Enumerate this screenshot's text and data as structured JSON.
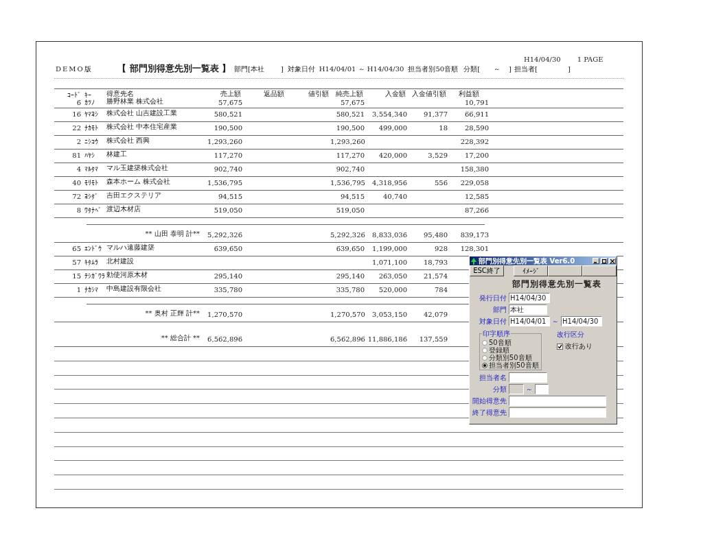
{
  "report": {
    "edition": "DEMO版",
    "title": "【 部門別得意先別一覧表 】",
    "department": "部門[本社",
    "department_close": "]",
    "period_label": "対象日付",
    "period": "H14/04/01 ～ H14/04/30",
    "order": "担当者別50音順",
    "category_open": "分類[",
    "category_tilde": "～",
    "category_close": "]",
    "staff_open": "担当者[",
    "staff_close": "]",
    "issue_date": "H14/04/30",
    "page": "1 PAGE"
  },
  "table": {
    "columns": [
      "ｺｰﾄﾞ",
      "ｷｰ",
      "得意先名",
      "売上額",
      "返品額",
      "値引額",
      "純売上額",
      "入金額",
      "入金値引額",
      "利益額"
    ],
    "rows": [
      {
        "kind": "item",
        "code": "6",
        "kana": "ｶﾂﾉ",
        "name": "勝野林業 株式会社",
        "sales": "57,675",
        "net": "57,675",
        "profit": "10,791"
      },
      {
        "kind": "item",
        "code": "16",
        "kana": "ﾔﾏﾖｼ",
        "name": "株式会社 山吉建設工業",
        "sales": "580,521",
        "net": "580,521",
        "receipt": "3,554,340",
        "receipt_discount": "91,377",
        "profit": "66,911"
      },
      {
        "kind": "item",
        "code": "22",
        "kana": "ﾅｶﾓﾄ",
        "name": "株式会社 中本住宅産業",
        "sales": "190,500",
        "net": "190,500",
        "receipt": "499,000",
        "receipt_discount": "18",
        "profit": "28,590"
      },
      {
        "kind": "item",
        "code": "2",
        "kana": "ﾆｼｺｳ",
        "name": "株式会社 西興",
        "sales": "1,293,260",
        "net": "1,293,260",
        "profit": "228,392"
      },
      {
        "kind": "item",
        "code": "81",
        "kana": "ﾊﾔｼ",
        "name": "林建工",
        "sales": "117,270",
        "net": "117,270",
        "receipt": "420,000",
        "receipt_discount": "3,529",
        "profit": "17,200"
      },
      {
        "kind": "item",
        "code": "4",
        "kana": "ﾏﾙﾀﾏ",
        "name": "マル玉建築株式会社",
        "sales": "902,740",
        "net": "902,740",
        "profit": "158,380"
      },
      {
        "kind": "item",
        "code": "40",
        "kana": "ﾓﾘﾓﾄ",
        "name": "森本ホーム 株式会社",
        "sales": "1,536,795",
        "net": "1,536,795",
        "receipt": "4,318,956",
        "receipt_discount": "556",
        "profit": "229,058"
      },
      {
        "kind": "item",
        "code": "72",
        "kana": "ﾖｼﾀﾞ",
        "name": "吉田エクステリア",
        "sales": "94,515",
        "net": "94,515",
        "receipt": "40,740",
        "profit": "12,585"
      },
      {
        "kind": "item",
        "code": "8",
        "kana": "ﾜﾀﾅﾍﾞ",
        "name": "渡辺木材店",
        "sales": "519,050",
        "net": "519,050",
        "profit": "87,266"
      },
      {
        "kind": "subtotal",
        "label": "** 山田 泰明 計**",
        "sales": "5,292,326",
        "net": "5,292,326",
        "receipt": "8,833,036",
        "receipt_discount": "95,480",
        "profit": "839,173"
      },
      {
        "kind": "item",
        "code": "65",
        "kana": "ｴﾝﾄﾞｳ",
        "name": "マルハ遠藤建築",
        "sales": "639,650",
        "net": "639,650",
        "receipt": "1,199,000",
        "receipt_discount": "928",
        "profit": "128,301"
      },
      {
        "kind": "item",
        "code": "57",
        "kana": "ｷﾀﾑﾗ",
        "name": "北村建設",
        "receipt": "1,071,100",
        "receipt_discount": "18,793"
      },
      {
        "kind": "item",
        "code": "15",
        "kana": "ﾃｼｶﾞﾜﾗ",
        "name": "勅使河原木材",
        "sales": "295,140",
        "net": "295,140",
        "receipt": "263,050",
        "receipt_discount": "21,574"
      },
      {
        "kind": "item",
        "code": "1",
        "kana": "ﾅｶｼﾏ",
        "name": "中島建設有限会社",
        "sales": "335,780",
        "net": "335,780",
        "receipt": "520,000",
        "receipt_discount": "784"
      },
      {
        "kind": "subtotal",
        "label": "** 奥村 正輝 計**",
        "sales": "1,270,570",
        "net": "1,270,570",
        "receipt": "3,053,150",
        "receipt_discount": "42,079"
      },
      {
        "kind": "total",
        "label": "** 総合計 **",
        "sales": "6,562,896",
        "net": "6,562,896",
        "receipt": "11,886,186",
        "receipt_discount": "137,559"
      }
    ]
  },
  "dialog": {
    "title": "部門別得意先別一覧表 Ver6.0",
    "toolbar": [
      "ESC終了",
      "ｲﾒｰｼﾞ"
    ],
    "heading": "部門別得意先別一覧表",
    "issue_date": {
      "label": "発行日付",
      "value": "H14/04/30"
    },
    "department": {
      "label": "部門",
      "value": "本社"
    },
    "period": {
      "label": "対象日付",
      "from": "H14/04/01",
      "separator": "～",
      "to": "H14/04/30"
    },
    "print_order": {
      "legend": "印字順序",
      "options": [
        {
          "label": "50音順",
          "selected": false
        },
        {
          "label": "登録順",
          "selected": false
        },
        {
          "label": "分類別50音順",
          "selected": false
        },
        {
          "label": "担当者別50音順",
          "selected": true
        }
      ]
    },
    "line_break": {
      "label": "改行区分",
      "option": "改行あり",
      "checked": true
    },
    "staff": {
      "label": "担当者名"
    },
    "category": {
      "label": "分類",
      "separator": "～",
      "from_disabled": true
    },
    "start_customer": {
      "label": "開始得意先"
    },
    "end_customer": {
      "label": "終了得意先"
    }
  }
}
